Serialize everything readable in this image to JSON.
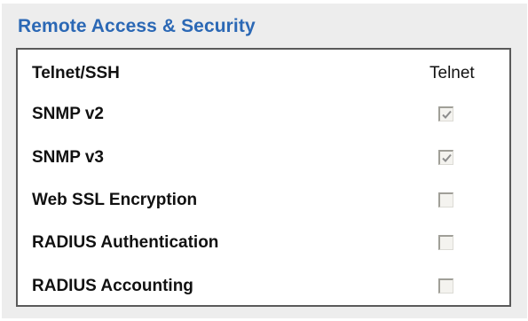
{
  "section": {
    "title": "Remote Access & Security",
    "header_label": "Telnet/SSH",
    "column_header": "Telnet",
    "rows": [
      {
        "label": "SNMP v2",
        "checked": true
      },
      {
        "label": "SNMP v3",
        "checked": true
      },
      {
        "label": "Web SSL Encryption",
        "checked": false
      },
      {
        "label": "RADIUS Authentication",
        "checked": false
      },
      {
        "label": "RADIUS Accounting",
        "checked": false
      }
    ]
  },
  "colors": {
    "title": "#2b68b5",
    "panel_background": "#ededed",
    "box_border": "#5a5a5a",
    "checkmark": "#8d8d8d"
  }
}
